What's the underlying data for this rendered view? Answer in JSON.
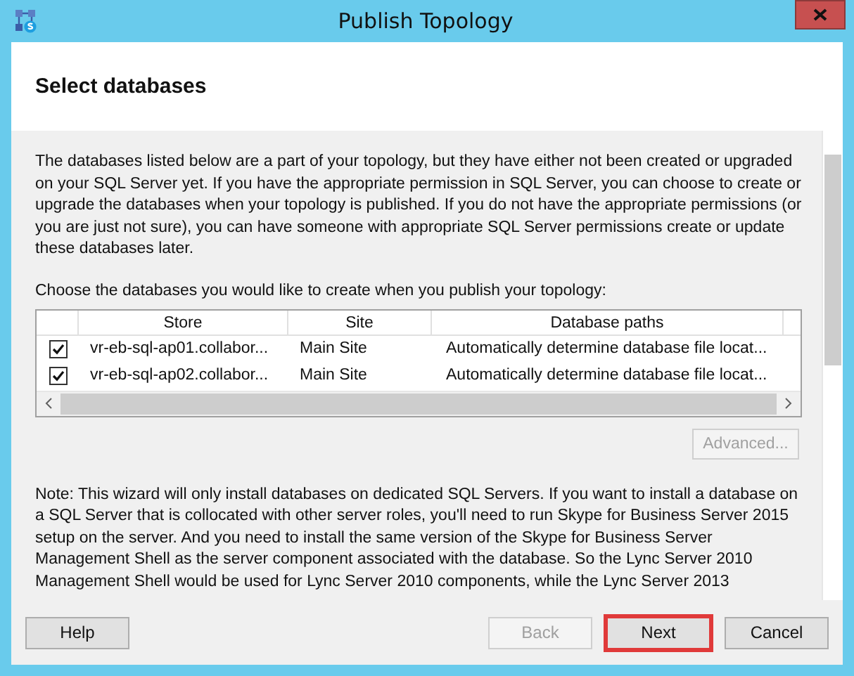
{
  "window": {
    "title": "Publish Topology"
  },
  "header": "Select databases",
  "intro": "The databases listed below are a part of your topology, but they have either not been created or upgraded on your SQL Server yet. If you have the appropriate permission in SQL Server, you can choose to create or upgrade the databases when your topology is published. If you do not have the appropriate permissions (or you are just not sure), you can have someone with appropriate SQL Server permissions create or update these databases later.",
  "choose_label": "Choose the databases you would like to create when you publish your topology:",
  "table": {
    "columns": [
      "Store",
      "Site",
      "Database paths"
    ],
    "rows": [
      {
        "checked": true,
        "store": "vr-eb-sql-ap01.collabor...",
        "site": "Main Site",
        "path": "Automatically determine database file locat..."
      },
      {
        "checked": true,
        "store": "vr-eb-sql-ap02.collabor...",
        "site": "Main Site",
        "path": "Automatically determine database file locat..."
      }
    ]
  },
  "advanced_button": {
    "label": "Advanced...",
    "disabled": true
  },
  "note": "Note: This wizard will only install databases on dedicated SQL Servers. If you want to install a database on a SQL Server that is collocated with other server roles, you'll need to run Skype for Business Server 2015 setup on the server. And you need to install the same version of the Skype for Business Server Management Shell as the server component associated with the database. So the Lync Server 2010 Management Shell would be used for Lync Server 2010 components, while the Lync Server 2013",
  "buttons": [
    {
      "label": "Help",
      "disabled": false,
      "highlighted": false
    },
    {
      "label": "Back",
      "disabled": true,
      "highlighted": false
    },
    {
      "label": "Next",
      "disabled": false,
      "highlighted": true
    },
    {
      "label": "Cancel",
      "disabled": false,
      "highlighted": false
    }
  ]
}
